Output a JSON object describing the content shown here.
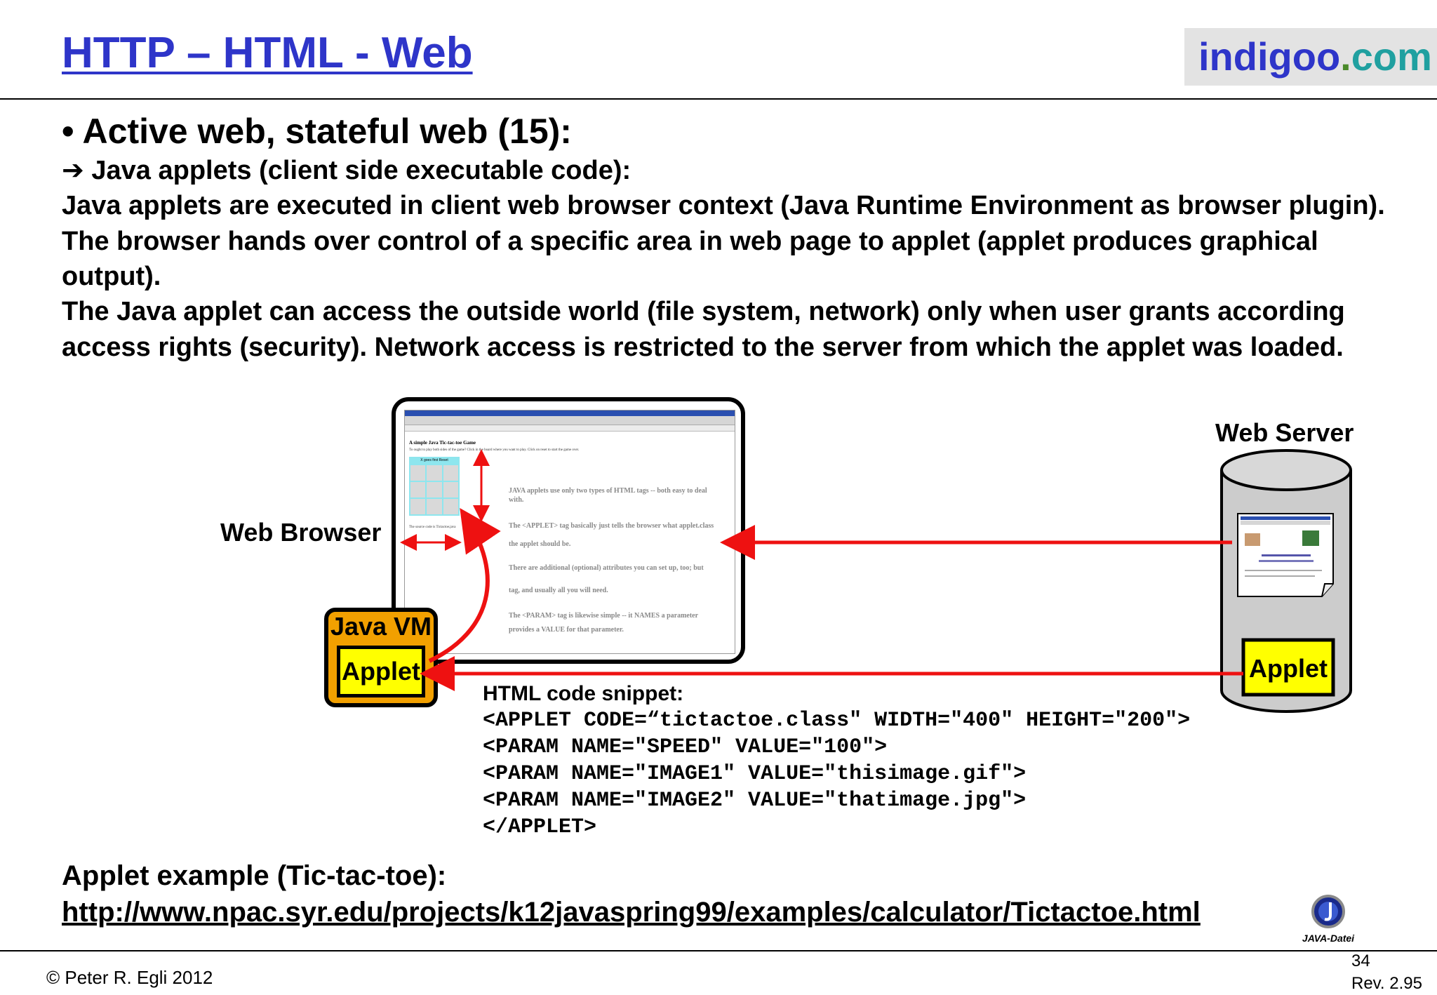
{
  "header": {
    "title": "HTTP – HTML - Web",
    "logo_part1": "indigoo",
    "logo_part2": ".",
    "logo_part3": "com"
  },
  "content": {
    "bullet": "• Active web, stateful web (15):",
    "subheading_arrow": "➔",
    "subheading": "Java applets (client side executable code):",
    "paragraph1": "Java applets are executed in client web browser context (Java Runtime Environment as browser plugin). The browser hands over control of a specific area in web page to applet (applet produces graphical output).",
    "paragraph2": "The Java applet can access the outside world (file system, network) only when user grants according access rights (security). Network access is restricted to the server from which the applet was loaded."
  },
  "diagram": {
    "web_browser_label": "Web Browser",
    "web_server_label": "Web Server",
    "java_vm_label": "Java VM",
    "applet_client_label": "Applet",
    "applet_server_label": "Applet",
    "browser_page": {
      "heading": "A simple Java Tic-tac-toe Game",
      "tagline": "To ought to play both sides of the game? Click in the board where you want to play. Click on reset to start the game over.",
      "board_header": "X goes first   Reset",
      "source_line": "The source code is Tictactoe.java",
      "lines": [
        "JAVA applets use only two types of HTML tags -- both easy to deal with.",
        "The <APPLET> tag basically just tells the browser what applet.class",
        "the applet should be.",
        "There are additional (optional) attributes you can set up, too; but",
        "tag, and usually all you will need.",
        "The <PARAM> tag is likewise simple -- it NAMES a parameter",
        "provides a VALUE for that parameter."
      ]
    },
    "colors": {
      "arrow": "#ee1111",
      "jvm": "#f2a000",
      "applet": "#ffff00",
      "server": "#cccccc"
    }
  },
  "code": {
    "heading": "HTML code snippet:",
    "lines": [
      "<APPLET CODE=“tictactoe.class\" WIDTH=\"400\" HEIGHT=\"200\">",
      "<PARAM NAME=\"SPEED\" VALUE=\"100\">",
      "<PARAM NAME=\"IMAGE1\" VALUE=\"thisimage.gif\">",
      "<PARAM NAME=\"IMAGE2\" VALUE=\"thatimage.jpg\">",
      "</APPLET>"
    ]
  },
  "example": {
    "label": "Applet example (Tic-tac-toe):",
    "url": "http://www.npac.syr.edu/projects/k12javaspring99/examples/calculator/Tictactoe.html"
  },
  "footer": {
    "copyright": "© Peter R. Egli 2012",
    "page": "34",
    "revision": "Rev. 2.95",
    "java_logo_text": "JAVA-Datei",
    "java_logo_icon": "java-logo-icon"
  }
}
